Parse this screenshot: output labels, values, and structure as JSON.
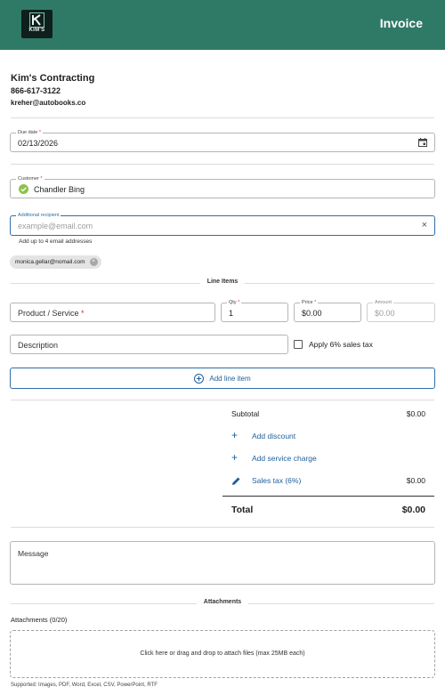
{
  "header": {
    "logo_text": "KIM'S",
    "title": "Invoice",
    "color": "#2f7a66"
  },
  "business": {
    "name": "Kim's Contracting",
    "phone": "866-617-3122",
    "email": "kreher@autobooks.co"
  },
  "due_date": {
    "label": "Due date",
    "value": "02/13/2026",
    "icon": "calendar-icon"
  },
  "customer": {
    "label": "Customer",
    "value": "Chandler Bing",
    "icon": "check-circle-icon"
  },
  "additional_recipient": {
    "label": "Additional recipient",
    "placeholder": "example@email.com",
    "helper": "Add up to 4 email addresses",
    "chips": [
      "monica.gellar@nomail.com"
    ]
  },
  "line_items": {
    "section_label": "Line Items",
    "product_placeholder": "Product / Service",
    "qty_label": "Qty",
    "qty_value": "1",
    "price_label": "Price",
    "price_value": "$0.00",
    "amount_label": "Amount",
    "amount_placeholder": "$0.00",
    "description_placeholder": "Description",
    "tax_checkbox_label": "Apply 6% sales tax",
    "add_button_label": "Add line item"
  },
  "summary": {
    "subtotal_label": "Subtotal",
    "subtotal_value": "$0.00",
    "discount_label": "Add discount",
    "service_charge_label": "Add service charge",
    "sales_tax_label": "Sales tax (6%)",
    "sales_tax_value": "$0.00",
    "total_label": "Total",
    "total_value": "$0.00"
  },
  "message": {
    "placeholder": "Message"
  },
  "attachments": {
    "section_label": "Attachments",
    "count_label": "Attachments (0/20)",
    "dropzone_text": "Click here or drag and drop to attach files (max 25MB each)",
    "supported_text": "Supported: Images, PDF, Word, Excel, CSV, PowerPoint, RTF"
  }
}
